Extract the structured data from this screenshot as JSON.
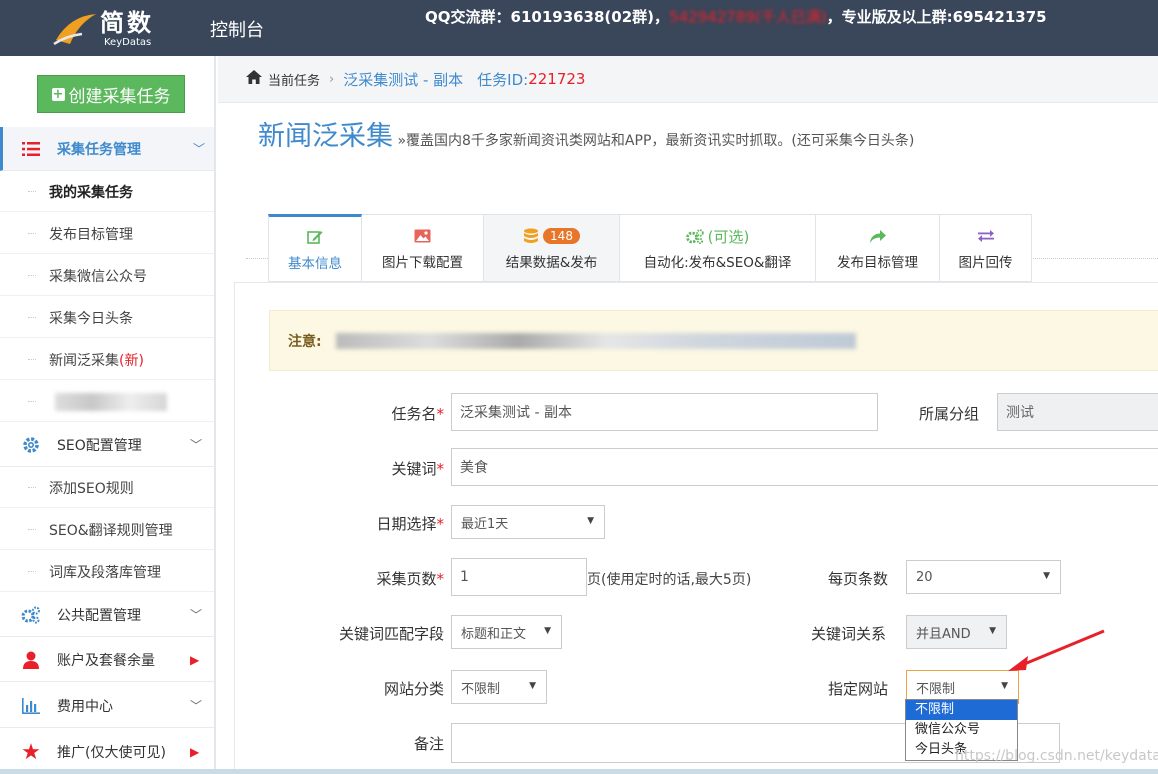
{
  "header": {
    "logo_cn": "简数",
    "logo_en": "KeyDatas",
    "console_label": "控制台",
    "qq_prefix": "QQ交流群：610193638(02群)，",
    "qq_full_group": "542942789(千人已满)",
    "qq_suffix": "，专业版及以上群:695421375"
  },
  "sidebar": {
    "create_button": "创建采集任务",
    "task_section": "采集任务管理",
    "task_items": [
      "我的采集任务",
      "发布目标管理",
      "采集微信公众号",
      "采集今日头条",
      "新闻泛采集"
    ],
    "new_tag": "(新)",
    "seo_section": "SEO配置管理",
    "seo_items": [
      "添加SEO规则",
      "SEO&翻译规则管理",
      "词库及段落库管理"
    ],
    "public_section": "公共配置管理",
    "account_section": "账户及套餐余量",
    "fee_section": "费用中心",
    "promo_section": "推广(仅大使可见)"
  },
  "breadcrumb": {
    "current": "当前任务",
    "task_name": "泛采集测试 - 副本",
    "task_id_label": "任务ID:",
    "task_id_value": "221723"
  },
  "page": {
    "title": "新闻泛采集",
    "description": "»覆盖国内8千多家新闻资讯类网站和APP，最新资讯实时抓取。(还可采集今日头条)"
  },
  "tabs": [
    {
      "label": "基本信息"
    },
    {
      "label": "图片下载配置"
    },
    {
      "label": "结果数据&发布",
      "badge": "148"
    },
    {
      "label": "自动化:发布&SEO&翻译",
      "extra": "(可选)"
    },
    {
      "label": "发布目标管理"
    },
    {
      "label": "图片回传"
    }
  ],
  "notice_label": "注意:",
  "form": {
    "task_name_label": "任务名",
    "task_name_value": "泛采集测试 - 副本",
    "group_label": "所属分组",
    "group_value": "测试",
    "keyword_label": "关键词",
    "keyword_value": "美食",
    "date_label": "日期选择",
    "date_value": "最近1天",
    "pages_label": "采集页数",
    "pages_value": "1",
    "pages_hint": "页(使用定时的话,最大5页)",
    "per_page_label": "每页条数",
    "per_page_value": "20",
    "match_label": "关键词匹配字段",
    "match_value": "标题和正文",
    "relation_label": "关键词关系",
    "relation_value": "并且AND",
    "category_label": "网站分类",
    "category_value": "不限制",
    "site_label": "指定网站",
    "site_value": "不限制",
    "site_options": [
      "不限制",
      "微信公众号",
      "今日头条"
    ],
    "remark_label": "备注",
    "required_mark": "*"
  },
  "watermark": "https://blog.csdn.net/keydatas",
  "colors": {
    "accent": "#3e8acc",
    "topbar": "#3a4659",
    "create_green": "#5cb85c",
    "alert": "#e8202a",
    "badge": "#e8762a"
  }
}
